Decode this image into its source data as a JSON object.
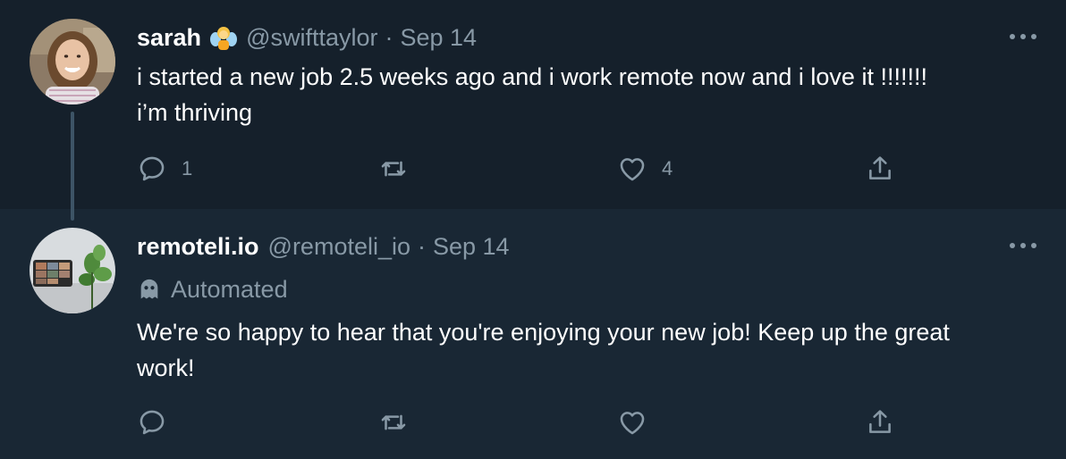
{
  "tweets": [
    {
      "display_name": "sarah",
      "handle": "@swifttaylor",
      "separator": "·",
      "date": "Sep 14",
      "text_lines": [
        "i started a new job 2.5 weeks ago and i work remote now and i love it !!!!!!!",
        "i’m thriving"
      ],
      "reply_count": "1",
      "retweet_count": "",
      "like_count": "4"
    },
    {
      "display_name": "remoteli.io",
      "handle": "@remoteli_io",
      "separator": "·",
      "date": "Sep 14",
      "automated_label": "Automated",
      "text_lines": [
        "We're so happy to hear that you're enjoying your new job! Keep up the great",
        "work!"
      ],
      "reply_count": "",
      "retweet_count": "",
      "like_count": ""
    }
  ],
  "icons": {
    "more": "more-horizontal-icon",
    "reply": "reply-icon",
    "retweet": "retweet-icon",
    "like": "heart-icon",
    "share": "share-icon",
    "bot": "robot-icon"
  },
  "colors": {
    "background": "#15202b",
    "reply_background": "#192734",
    "secondary_text": "#8899a6",
    "thread_line": "#3d5466"
  }
}
